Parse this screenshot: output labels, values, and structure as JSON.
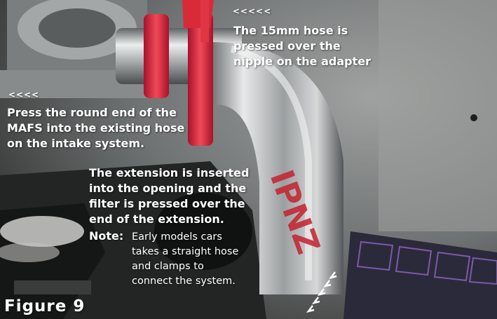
{
  "annotations": {
    "hose_arrows": "<<<<<",
    "hose_text": "The 15mm hose is\npressed over the\nnipple on the adapter",
    "mafs_arrows": "<<<<",
    "mafs_text": "Press the round end of the\nMAFS into the existing hose\non the intake system.",
    "extension_text": "The extension is inserted\ninto the opening and the\nfilter is pressed over the\nend of the extension.",
    "note_label": "Note:",
    "note_text": "Early  models cars\n takes a straight hose\nand clamps to\nconnect the system.",
    "figure_label": "Figure  9"
  },
  "photo": {
    "subject": "intake-pipe-engine-bay",
    "colors": {
      "background": "#6f7272",
      "chrome_pipe": "#c8cccc",
      "red_hose": "#d92a3a",
      "dark_engine": "#1b1c1c",
      "fuse_box": "#2b2a3a"
    }
  }
}
